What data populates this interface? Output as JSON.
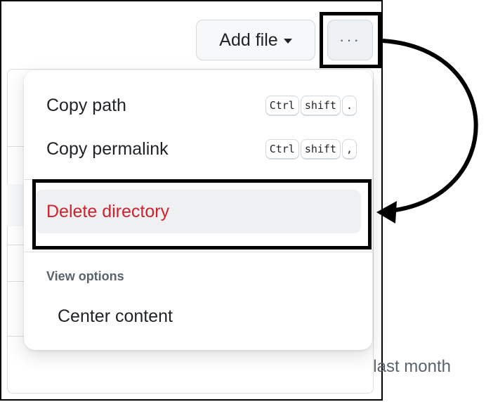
{
  "toolbar": {
    "add_file_label": "Add file",
    "more_label": "···"
  },
  "menu": {
    "items": [
      {
        "label": "Copy path",
        "shortcut": [
          "Ctrl",
          "shift",
          "."
        ]
      },
      {
        "label": "Copy permalink",
        "shortcut": [
          "Ctrl",
          "shift",
          ","
        ]
      }
    ],
    "danger_item": {
      "label": "Delete directory"
    },
    "view_options": {
      "heading": "View options",
      "items": [
        {
          "label": "Center content"
        }
      ]
    }
  },
  "background": {
    "timestamp": "last month"
  },
  "colors": {
    "danger": "#cf222e",
    "annotation": "#000000"
  }
}
